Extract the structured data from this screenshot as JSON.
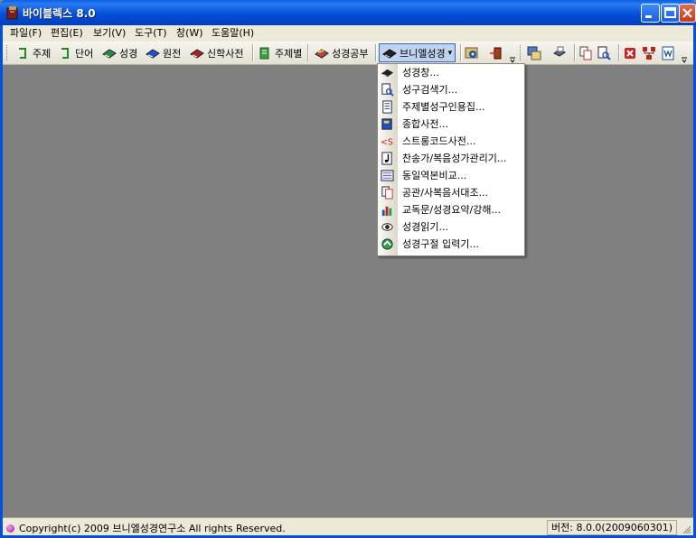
{
  "window": {
    "title": "바이블렉스 8.0"
  },
  "menubar": [
    "파일(F)",
    "편집(E)",
    "보기(V)",
    "도구(T)",
    "창(W)",
    "도움말(H)"
  ],
  "toolbar": {
    "buttons": [
      {
        "label": "주제",
        "icon": "green-bracket-icon"
      },
      {
        "label": "단어",
        "icon": "green-bracket-icon"
      },
      {
        "label": "성경",
        "icon": "green-book-icon"
      },
      {
        "label": "원전",
        "icon": "blue-book-icon"
      },
      {
        "label": "신학사전",
        "icon": "red-book-icon"
      },
      {
        "label": "주제별",
        "icon": "green-topic-icon"
      },
      {
        "label": "성경공부",
        "icon": "study-book-icon"
      },
      {
        "label": "브니엘성경",
        "icon": "black-book-icon",
        "dropdown": "▾"
      }
    ]
  },
  "dropdown_menu": {
    "items": [
      {
        "label": "성경창...",
        "icon": "bible-icon"
      },
      {
        "label": "성구검색기...",
        "icon": "search-doc-icon"
      },
      {
        "label": "주제별성구인용집...",
        "icon": "document-icon"
      },
      {
        "label": "종합사전...",
        "icon": "dictionary-icon"
      },
      {
        "label": "스트롱코드사전...",
        "icon": "strong-code-icon"
      },
      {
        "label": "찬송가/복음성가관리기...",
        "icon": "music-note-icon"
      },
      {
        "label": "동일역본비교...",
        "icon": "compare-icon"
      },
      {
        "label": "공관/사복음서대조...",
        "icon": "gospel-compare-icon"
      },
      {
        "label": "교독문/성경요약/강해...",
        "icon": "bar-chart-icon"
      },
      {
        "label": "성경읽기...",
        "icon": "eye-icon"
      },
      {
        "label": "성경구절 입력기...",
        "icon": "verse-input-icon"
      }
    ]
  },
  "statusbar": {
    "copyright": "Copyright(c) 2009 브니엘성경연구소 All rights Reserved.",
    "version": "버전: 8.0.0(2009060301)"
  }
}
